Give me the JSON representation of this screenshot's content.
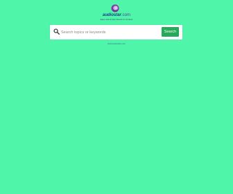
{
  "brand": {
    "name": "audiostar",
    "tld": ".com",
    "tagline": "Easy and simple Search in Context",
    "colors": {
      "background": "#4ff5a8",
      "button": "#27a95a",
      "name": "#1d3a8a"
    }
  },
  "search": {
    "placeholder": "Search topics or keywords",
    "value": "",
    "button_label": "Search",
    "icon": "search-icon"
  },
  "footer": {
    "link_text": "www.audiostar.com"
  }
}
